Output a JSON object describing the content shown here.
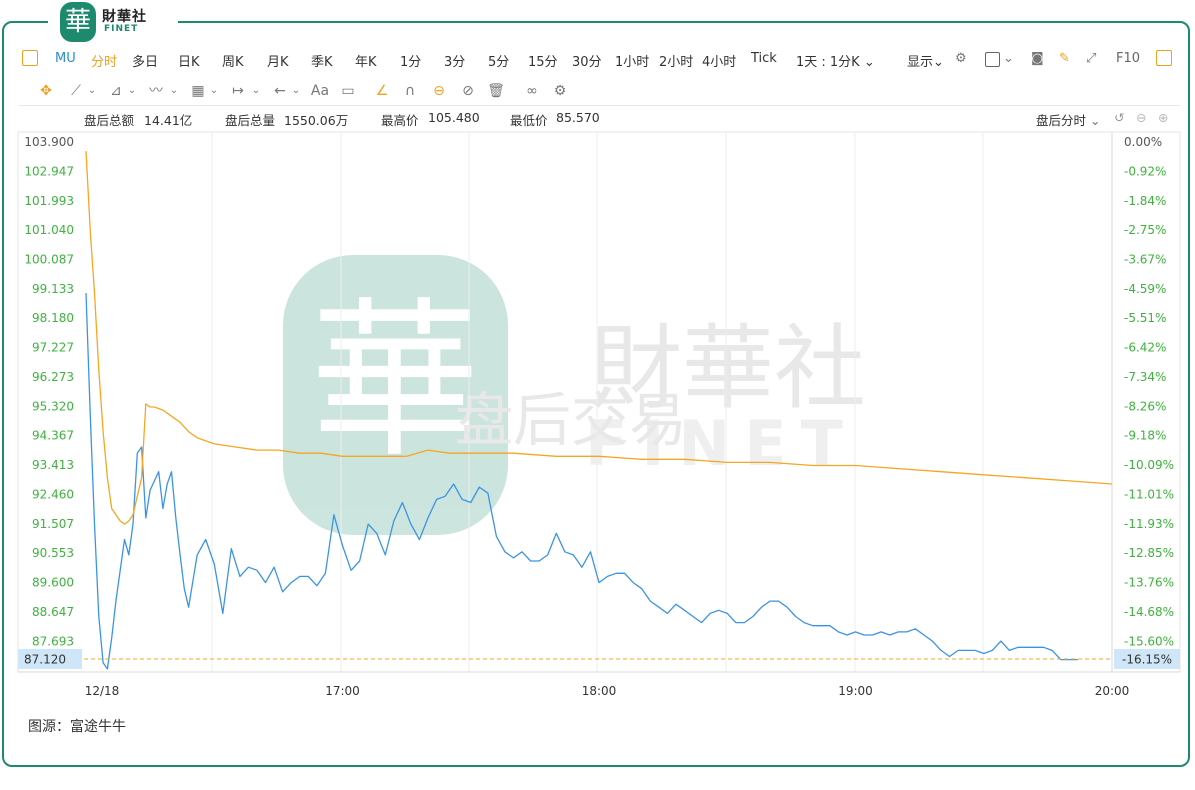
{
  "brand": {
    "seal": "華",
    "cn": "財華社",
    "en": "FINET"
  },
  "toolbar": {
    "panel_icon": "panel-icon",
    "symbol": "MU",
    "items": [
      "分时",
      "多日",
      "日K",
      "周K",
      "月K",
      "季K",
      "年K",
      "1分",
      "3分",
      "5分",
      "15分",
      "30分",
      "1小时",
      "2小时",
      "4小时",
      "Tick"
    ],
    "active": "分时",
    "period_select": "1天 : 1分K",
    "display": "显示",
    "f10": "F10"
  },
  "drawing_tools": [
    "move-icon",
    "line-icon",
    "ray-icon",
    "wave-icon",
    "fib-icon",
    "measure-icon",
    "arrow-icon",
    "text-icon",
    "comment-icon",
    "pen-icon",
    "magnet-icon",
    "lock-icon",
    "hide-icon",
    "trash-icon",
    "link-icon",
    "settings-icon"
  ],
  "info": {
    "total_amount_label": "盘后总额",
    "total_amount": "14.41亿",
    "total_volume_label": "盘后总量",
    "total_volume": "1550.06万",
    "high_label": "最高价",
    "high": "105.480",
    "low_label": "最低价",
    "low": "85.570",
    "mode": "盘后分时"
  },
  "watermark": {
    "cn": "財華社",
    "en": "FINET",
    "sub": "盘后交易"
  },
  "source": "图源：富途牛牛",
  "colors": {
    "price": "#3a94e6",
    "avg": "#f5a623",
    "axis_green": "#3db33d",
    "accent": "#f0a020",
    "frame": "#1d8a6e"
  },
  "chart_data": {
    "type": "line",
    "title": "",
    "x_tick_labels": [
      "12/18",
      "17:00",
      "18:00",
      "19:00",
      "20:00"
    ],
    "x_range": [
      "16:00",
      "20:00"
    ],
    "y_tick_labels": [
      "103.900",
      "102.947",
      "101.993",
      "101.040",
      "100.087",
      "99.133",
      "98.180",
      "97.227",
      "96.273",
      "95.320",
      "94.367",
      "93.413",
      "92.460",
      "91.507",
      "90.553",
      "89.600",
      "88.647",
      "87.693"
    ],
    "y_right_tick_labels": [
      "0.00%",
      "-0.92%",
      "-1.84%",
      "-2.75%",
      "-3.67%",
      "-4.59%",
      "-5.51%",
      "-6.42%",
      "-7.34%",
      "-8.26%",
      "-9.18%",
      "-10.09%",
      "-11.01%",
      "-11.93%",
      "-12.85%",
      "-13.76%",
      "-14.68%",
      "-15.60%"
    ],
    "ylim": [
      86.74,
      103.9
    ],
    "last_price": "87.120",
    "last_pct": "-16.15%",
    "series": [
      {
        "role": "price",
        "x_minutes": [
          0,
          1,
          2,
          3,
          4,
          5,
          6,
          7,
          8,
          9,
          10,
          11,
          12,
          13,
          14,
          15,
          16,
          17,
          18,
          19,
          20,
          21,
          22,
          23,
          24,
          26,
          28,
          30,
          32,
          34,
          36,
          38,
          40,
          42,
          44,
          46,
          48,
          50,
          52,
          54,
          56,
          58,
          60,
          62,
          64,
          66,
          68,
          70,
          72,
          74,
          76,
          78,
          80,
          82,
          84,
          86,
          88,
          90,
          92,
          94,
          96,
          98,
          100,
          102,
          104,
          106,
          108,
          110,
          112,
          114,
          116,
          118,
          120,
          122,
          124,
          126,
          128,
          130,
          132,
          134,
          136,
          138,
          140,
          142,
          144,
          146,
          148,
          150,
          152,
          154,
          156,
          158,
          160,
          162,
          164,
          166,
          168,
          170,
          172,
          174,
          176,
          178,
          180,
          182,
          184,
          186,
          188,
          190,
          192,
          194,
          196,
          198,
          200,
          202,
          204,
          206,
          208,
          210,
          212,
          214,
          216,
          218,
          220,
          222,
          224,
          226,
          228,
          230,
          232,
          234,
          236,
          238,
          240
        ],
        "values": [
          99.0,
          95.0,
          91.5,
          88.5,
          87.0,
          86.8,
          87.8,
          89.0,
          90.0,
          91.0,
          90.5,
          91.5,
          93.8,
          94.0,
          91.7,
          92.6,
          92.9,
          93.2,
          92.0,
          92.8,
          93.2,
          91.7,
          90.5,
          89.4,
          88.8,
          90.5,
          91.0,
          90.2,
          88.6,
          90.7,
          89.8,
          90.1,
          90.0,
          89.6,
          90.1,
          89.3,
          89.6,
          89.8,
          89.8,
          89.5,
          89.9,
          91.8,
          90.8,
          90.0,
          90.3,
          91.5,
          91.2,
          90.5,
          91.6,
          92.2,
          91.5,
          91.0,
          91.7,
          92.3,
          92.4,
          92.8,
          92.3,
          92.2,
          92.7,
          92.5,
          91.1,
          90.6,
          90.4,
          90.6,
          90.3,
          90.3,
          90.5,
          91.2,
          90.6,
          90.5,
          90.1,
          90.6,
          89.6,
          89.8,
          89.9,
          89.9,
          89.6,
          89.4,
          89.0,
          88.8,
          88.6,
          88.9,
          88.7,
          88.5,
          88.3,
          88.6,
          88.7,
          88.6,
          88.3,
          88.3,
          88.5,
          88.8,
          89.0,
          89.0,
          88.8,
          88.5,
          88.3,
          88.2,
          88.2,
          88.2,
          88.0,
          87.9,
          88.0,
          87.9,
          87.9,
          88.0,
          87.9,
          88.0,
          88.0,
          88.1,
          87.9,
          87.7,
          87.4,
          87.2,
          87.4,
          87.4,
          87.4,
          87.3,
          87.4,
          87.7,
          87.4,
          87.5,
          87.5,
          87.5,
          87.5,
          87.4,
          87.1,
          87.1,
          87.1
        ]
      },
      {
        "role": "average",
        "x_minutes": [
          0,
          1,
          2,
          3,
          4,
          5,
          6,
          7,
          8,
          9,
          10,
          11,
          12,
          13,
          14,
          15,
          16,
          18,
          20,
          22,
          24,
          26,
          28,
          30,
          35,
          40,
          45,
          50,
          55,
          60,
          65,
          70,
          75,
          80,
          85,
          90,
          95,
          100,
          110,
          120,
          130,
          140,
          150,
          160,
          170,
          180,
          190,
          200,
          210,
          220,
          230,
          240
        ],
        "values": [
          103.6,
          101.0,
          99.0,
          96.5,
          94.5,
          93.0,
          92.0,
          91.8,
          91.6,
          91.5,
          91.6,
          91.8,
          92.4,
          93.0,
          95.4,
          95.3,
          95.3,
          95.2,
          95.0,
          94.8,
          94.5,
          94.3,
          94.2,
          94.1,
          94.0,
          93.9,
          93.9,
          93.8,
          93.8,
          93.7,
          93.7,
          93.7,
          93.7,
          93.9,
          93.8,
          93.8,
          93.8,
          93.8,
          93.7,
          93.7,
          93.6,
          93.6,
          93.5,
          93.5,
          93.4,
          93.4,
          93.3,
          93.2,
          93.1,
          93.0,
          92.9,
          92.8
        ]
      }
    ]
  }
}
